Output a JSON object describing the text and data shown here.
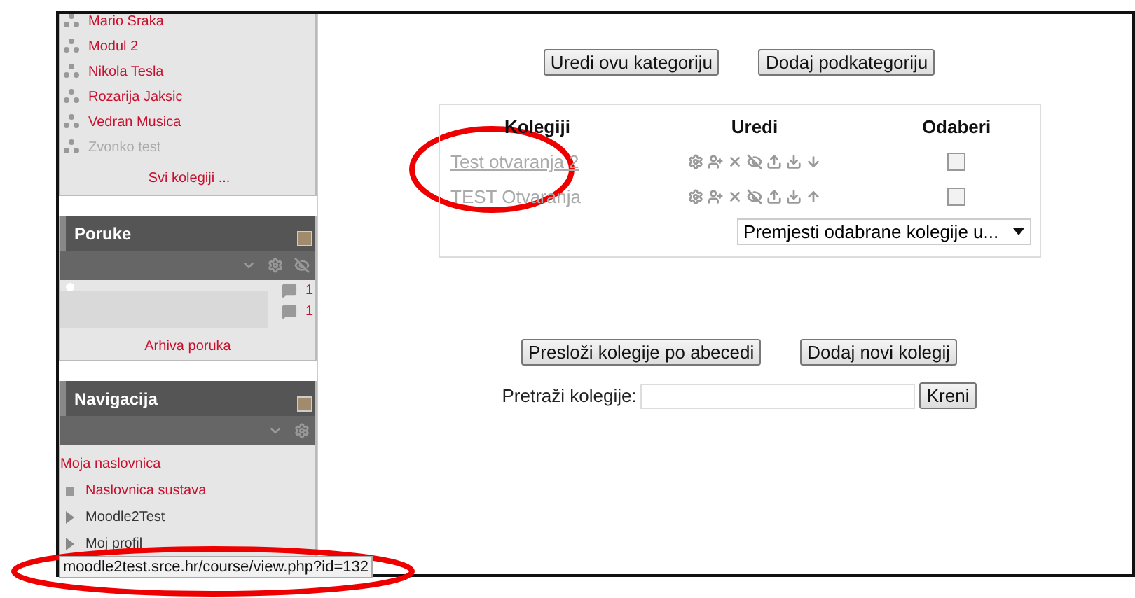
{
  "sidebar": {
    "courses": {
      "items": [
        {
          "label": "Mario Sraka",
          "disabled": false
        },
        {
          "label": "Modul 2",
          "disabled": false
        },
        {
          "label": "Nikola Tesla",
          "disabled": false
        },
        {
          "label": "Rozarija Jaksic",
          "disabled": false
        },
        {
          "label": "Vedran Musica",
          "disabled": false
        },
        {
          "label": "Zvonko test",
          "disabled": true
        }
      ],
      "all_link": "Svi kolegiji ..."
    },
    "messages": {
      "title": "Poruke",
      "items": [
        {
          "count": "1"
        },
        {
          "count": "1"
        }
      ],
      "archive_link": "Arhiva poruka"
    },
    "navigation": {
      "title": "Navigacija",
      "items": [
        {
          "label": "Moja naslovnica",
          "kind": "link"
        },
        {
          "label": "Naslovnica sustava",
          "kind": "bullet"
        },
        {
          "label": "Moodle2Test",
          "kind": "branch"
        },
        {
          "label": "Moj profil",
          "kind": "branch"
        }
      ]
    }
  },
  "main": {
    "top_buttons": [
      "Uredi ovu kategoriju",
      "Dodaj podkategoriju"
    ],
    "table": {
      "columns": [
        "Kolegiji",
        "Uredi",
        "Odaberi"
      ],
      "rows": [
        {
          "name": "Test otvaranja 2",
          "hovered": true,
          "move_down": true,
          "checked": false
        },
        {
          "name": "TEST Otvaranja",
          "hovered": false,
          "move_down": false,
          "checked": false
        }
      ]
    },
    "move_select": "Premjesti odabrane kolegije u...",
    "bottom_buttons": [
      "Presloži kolegije po abecedi",
      "Dodaj novi kolegij"
    ],
    "search": {
      "label": "Pretraži kolegije:",
      "button": "Kreni"
    }
  },
  "status_bar": "moodle2test.srce.hr/course/view.php?id=132"
}
